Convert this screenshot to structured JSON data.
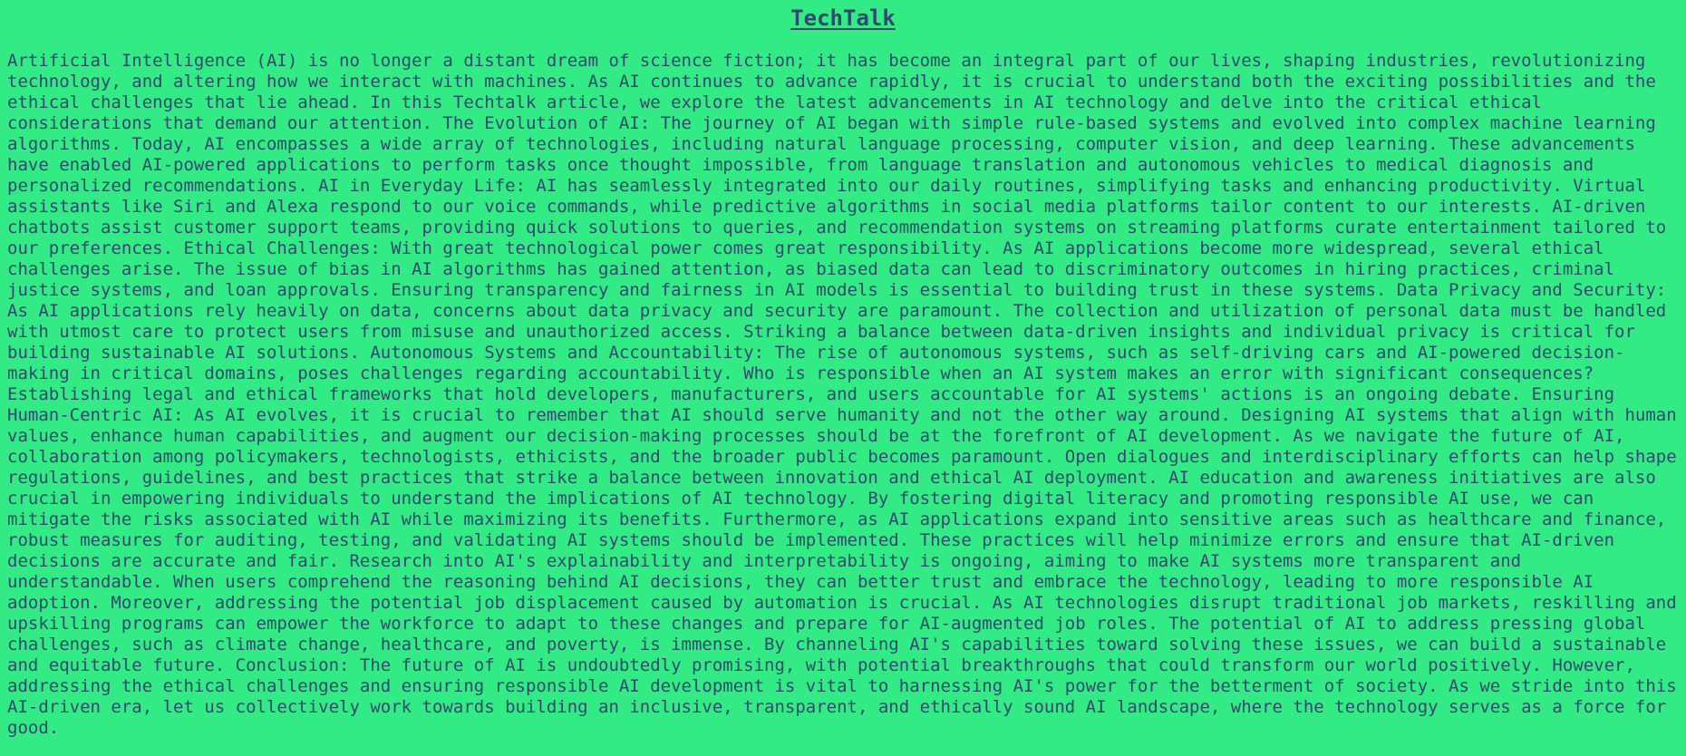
{
  "header": {
    "title": "TechTalk"
  },
  "article": {
    "body": "Artificial Intelligence (AI) is no longer a distant dream of science fiction; it has become an integral part of our lives, shaping industries, revolutionizing technology, and altering how we interact with machines. As AI continues to advance rapidly, it is crucial to understand both the exciting possibilities and the ethical challenges that lie ahead. In this Techtalk article, we explore the latest advancements in AI technology and delve into the critical ethical considerations that demand our attention. The Evolution of AI: The journey of AI began with simple rule-based systems and evolved into complex machine learning algorithms. Today, AI encompasses a wide array of technologies, including natural language processing, computer vision, and deep learning. These advancements have enabled AI-powered applications to perform tasks once thought impossible, from language translation and autonomous vehicles to medical diagnosis and personalized recommendations. AI in Everyday Life: AI has seamlessly integrated into our daily routines, simplifying tasks and enhancing productivity. Virtual assistants like Siri and Alexa respond to our voice commands, while predictive algorithms in social media platforms tailor content to our interests. AI-driven chatbots assist customer support teams, providing quick solutions to queries, and recommendation systems on streaming platforms curate entertainment tailored to our preferences. Ethical Challenges: With great technological power comes great responsibility. As AI applications become more widespread, several ethical challenges arise. The issue of bias in AI algorithms has gained attention, as biased data can lead to discriminatory outcomes in hiring practices, criminal justice systems, and loan approvals. Ensuring transparency and fairness in AI models is essential to building trust in these systems. Data Privacy and Security: As AI applications rely heavily on data, concerns about data privacy and security are paramount. The collection and utilization of personal data must be handled with utmost care to protect users from misuse and unauthorized access. Striking a balance between data-driven insights and individual privacy is critical for building sustainable AI solutions. Autonomous Systems and Accountability: The rise of autonomous systems, such as self-driving cars and AI-powered decision-making in critical domains, poses challenges regarding accountability. Who is responsible when an AI system makes an error with significant consequences? Establishing legal and ethical frameworks that hold developers, manufacturers, and users accountable for AI systems' actions is an ongoing debate. Ensuring Human-Centric AI: As AI evolves, it is crucial to remember that AI should serve humanity and not the other way around. Designing AI systems that align with human values, enhance human capabilities, and augment our decision-making processes should be at the forefront of AI development. As we navigate the future of AI, collaboration among policymakers, technologists, ethicists, and the broader public becomes paramount. Open dialogues and interdisciplinary efforts can help shape regulations, guidelines, and best practices that strike a balance between innovation and ethical AI deployment. AI education and awareness initiatives are also crucial in empowering individuals to understand the implications of AI technology. By fostering digital literacy and promoting responsible AI use, we can mitigate the risks associated with AI while maximizing its benefits. Furthermore, as AI applications expand into sensitive areas such as healthcare and finance, robust measures for auditing, testing, and validating AI systems should be implemented. These practices will help minimize errors and ensure that AI-driven decisions are accurate and fair. Research into AI's explainability and interpretability is ongoing, aiming to make AI systems more transparent and understandable. When users comprehend the reasoning behind AI decisions, they can better trust and embrace the technology, leading to more responsible AI adoption. Moreover, addressing the potential job displacement caused by automation is crucial. As AI technologies disrupt traditional job markets, reskilling and upskilling programs can empower the workforce to adapt to these changes and prepare for AI-augmented job roles. The potential of AI to address pressing global challenges, such as climate change, healthcare, and poverty, is immense. By channeling AI's capabilities toward solving these issues, we can build a sustainable and equitable future. Conclusion: The future of AI is undoubtedly promising, with potential breakthroughs that could transform our world positively. However, addressing the ethical challenges and ensuring responsible AI development is vital to harnessing AI's power for the betterment of society. As we stride into this AI-driven era, let us collectively work towards building an inclusive, transparent, and ethically sound AI landscape, where the technology serves as a force for good."
  },
  "colors": {
    "background": "#33eb85",
    "text": "#2f4a6e"
  }
}
